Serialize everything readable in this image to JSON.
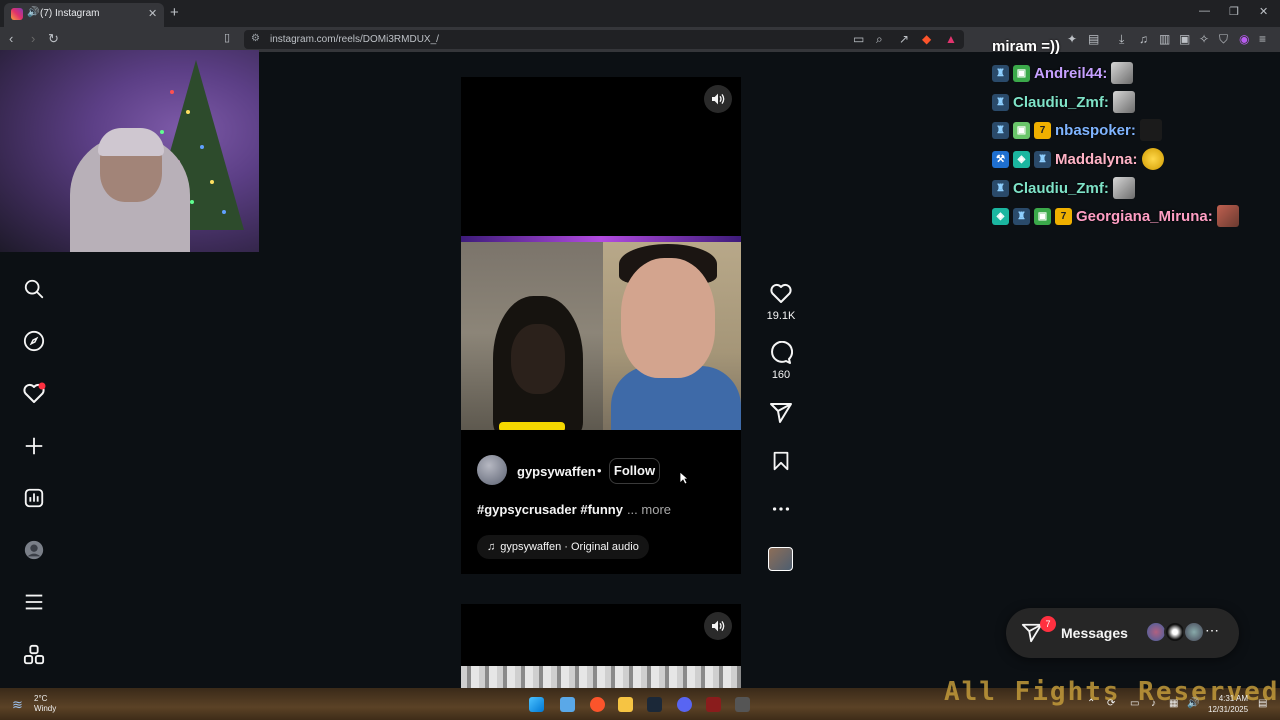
{
  "browser": {
    "tab_title": "(7) Instagram",
    "url": "instagram.com/reels/DOMi3RMDUX_/"
  },
  "post": {
    "username": "gypsywaffen",
    "separator": "•",
    "follow_label": "Follow",
    "caption": "#gypsycrusader #funny",
    "more_label": "· ... more",
    "audio": "gypsywaffen · Original audio"
  },
  "actions": {
    "likes": "19.1K",
    "comments": "160"
  },
  "chat": {
    "first_line": "miram =))",
    "users": [
      "Andreil44:",
      "Claudiu_Zmf:",
      "nbaspoker:",
      "Maddalyna:",
      "Claudiu_Zmf:",
      "Georgiana_Miruna:"
    ],
    "colors": [
      "#c6a0ff",
      "#7fe3c8",
      "#7fb4ff",
      "#ffb3c6",
      "#7fe3c8",
      "#ff9ec4"
    ]
  },
  "messages": {
    "label": "Messages",
    "badge": "7"
  },
  "taskbar": {
    "temperature": "2°C",
    "condition": "Windy",
    "time": "4:31 AM",
    "date": "12/31/2025",
    "overlay_text": "All Fights Reserved"
  }
}
